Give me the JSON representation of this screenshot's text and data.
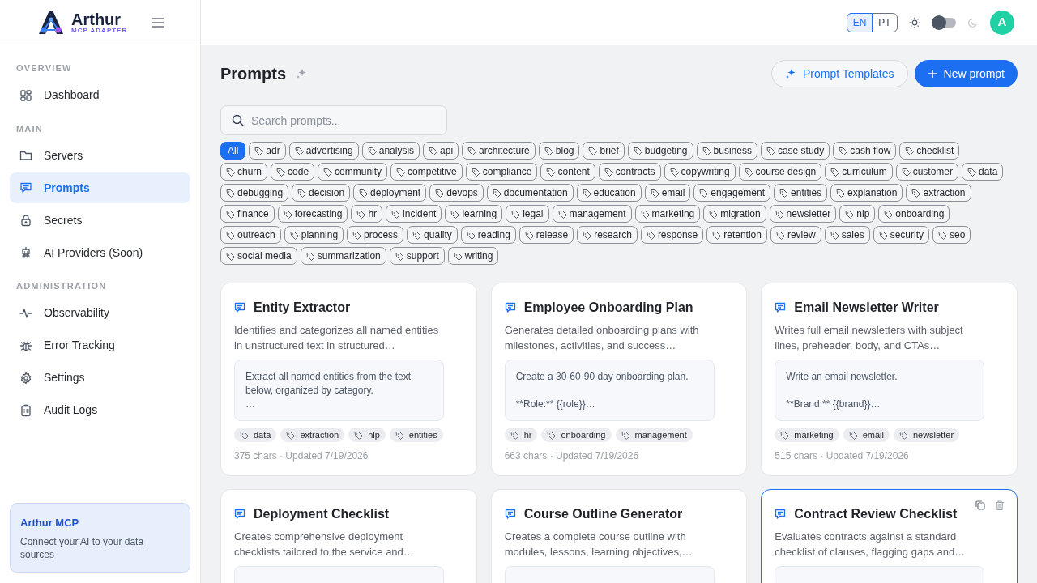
{
  "brand": {
    "name": "Arthur",
    "subtitle": "MCP ADAPTER"
  },
  "sidebar": {
    "sections": [
      {
        "title": "OVERVIEW",
        "items": [
          {
            "label": "Dashboard",
            "selected": false
          }
        ]
      },
      {
        "title": "MAIN",
        "items": [
          {
            "label": "Servers",
            "selected": false
          },
          {
            "label": "Prompts",
            "selected": true
          },
          {
            "label": "Secrets",
            "selected": false
          },
          {
            "label": "AI Providers (Soon)",
            "selected": false
          }
        ]
      },
      {
        "title": "ADMINISTRATION",
        "items": [
          {
            "label": "Observability",
            "selected": false
          },
          {
            "label": "Error Tracking",
            "selected": false
          },
          {
            "label": "Settings",
            "selected": false
          },
          {
            "label": "Audit Logs",
            "selected": false
          }
        ]
      }
    ],
    "info_card": {
      "title": "Arthur MCP",
      "text": "Connect your AI to your data sources"
    }
  },
  "topbar": {
    "languages": [
      {
        "label": "EN",
        "selected": true
      },
      {
        "label": "PT",
        "selected": false
      }
    ],
    "dark_mode": false,
    "avatar": "A"
  },
  "page": {
    "title": "Prompts",
    "buttons": [
      {
        "label": "Prompt Templates",
        "kind": "secondary"
      },
      {
        "label": "New prompt",
        "kind": "primary"
      }
    ],
    "search": {
      "placeholder": "Search prompts..."
    },
    "tag_filters": [
      {
        "label": "All",
        "selected": true
      },
      {
        "label": "adr",
        "selected": false
      },
      {
        "label": "advertising",
        "selected": false
      },
      {
        "label": "analysis",
        "selected": false
      },
      {
        "label": "api",
        "selected": false
      },
      {
        "label": "architecture",
        "selected": false
      },
      {
        "label": "blog",
        "selected": false
      },
      {
        "label": "brief",
        "selected": false
      },
      {
        "label": "budgeting",
        "selected": false
      },
      {
        "label": "business",
        "selected": false
      },
      {
        "label": "case study",
        "selected": false
      },
      {
        "label": "cash flow",
        "selected": false
      },
      {
        "label": "checklist",
        "selected": false
      },
      {
        "label": "churn",
        "selected": false
      },
      {
        "label": "code",
        "selected": false
      },
      {
        "label": "community",
        "selected": false
      },
      {
        "label": "competitive",
        "selected": false
      },
      {
        "label": "compliance",
        "selected": false
      },
      {
        "label": "content",
        "selected": false
      },
      {
        "label": "contracts",
        "selected": false
      },
      {
        "label": "copywriting",
        "selected": false
      },
      {
        "label": "course design",
        "selected": false
      },
      {
        "label": "curriculum",
        "selected": false
      },
      {
        "label": "customer",
        "selected": false
      },
      {
        "label": "data",
        "selected": false
      },
      {
        "label": "debugging",
        "selected": false
      },
      {
        "label": "decision",
        "selected": false
      },
      {
        "label": "deployment",
        "selected": false
      },
      {
        "label": "devops",
        "selected": false
      },
      {
        "label": "documentation",
        "selected": false
      },
      {
        "label": "education",
        "selected": false
      },
      {
        "label": "email",
        "selected": false
      },
      {
        "label": "engagement",
        "selected": false
      },
      {
        "label": "entities",
        "selected": false
      },
      {
        "label": "explanation",
        "selected": false
      },
      {
        "label": "extraction",
        "selected": false
      },
      {
        "label": "finance",
        "selected": false
      },
      {
        "label": "forecasting",
        "selected": false
      },
      {
        "label": "hr",
        "selected": false
      },
      {
        "label": "incident",
        "selected": false
      },
      {
        "label": "learning",
        "selected": false
      },
      {
        "label": "legal",
        "selected": false
      },
      {
        "label": "management",
        "selected": false
      },
      {
        "label": "marketing",
        "selected": false
      },
      {
        "label": "migration",
        "selected": false
      },
      {
        "label": "newsletter",
        "selected": false
      },
      {
        "label": "nlp",
        "selected": false
      },
      {
        "label": "onboarding",
        "selected": false
      },
      {
        "label": "outreach",
        "selected": false
      },
      {
        "label": "planning",
        "selected": false
      },
      {
        "label": "process",
        "selected": false
      },
      {
        "label": "quality",
        "selected": false
      },
      {
        "label": "reading",
        "selected": false
      },
      {
        "label": "release",
        "selected": false
      },
      {
        "label": "research",
        "selected": false
      },
      {
        "label": "response",
        "selected": false
      },
      {
        "label": "retention",
        "selected": false
      },
      {
        "label": "review",
        "selected": false
      },
      {
        "label": "sales",
        "selected": false
      },
      {
        "label": "security",
        "selected": false
      },
      {
        "label": "seo",
        "selected": false
      },
      {
        "label": "social media",
        "selected": false
      },
      {
        "label": "summarization",
        "selected": false
      },
      {
        "label": "support",
        "selected": false
      },
      {
        "label": "writing",
        "selected": false
      }
    ],
    "prompts": [
      {
        "title": "Entity Extractor",
        "description": "Identifies and categorizes all named entities in unstructured text in structured…",
        "preview": "Extract all named entities from the text below, organized by category.\n…",
        "tags": [
          "data",
          "extraction",
          "nlp",
          "entities"
        ],
        "meta": "375 chars · Updated 7/19/2026",
        "hovered": false
      },
      {
        "title": "Employee Onboarding Plan",
        "description": "Generates detailed onboarding plans with milestones, activities, and success…",
        "preview": "Create a 30-60-90 day onboarding plan.\n\n**Role:** {{role}}…",
        "tags": [
          "hr",
          "onboarding",
          "management"
        ],
        "meta": "663 chars · Updated 7/19/2026",
        "hovered": false
      },
      {
        "title": "Email Newsletter Writer",
        "description": "Writes full email newsletters with subject lines, preheader, body, and CTAs…",
        "preview": "Write an email newsletter.\n\n**Brand:** {{brand}}…",
        "tags": [
          "marketing",
          "email",
          "newsletter"
        ],
        "meta": "515 chars · Updated 7/19/2026",
        "hovered": false
      },
      {
        "title": "Deployment Checklist",
        "description": "Creates comprehensive deployment checklists tailored to the service and…",
        "hovered": false
      },
      {
        "title": "Course Outline Generator",
        "description": "Creates a complete course outline with modules, lessons, learning objectives,…",
        "hovered": false
      },
      {
        "title": "Contract Review Checklist",
        "description": "Evaluates contracts against a standard checklist of clauses, flagging gaps and…",
        "hovered": true
      }
    ]
  }
}
